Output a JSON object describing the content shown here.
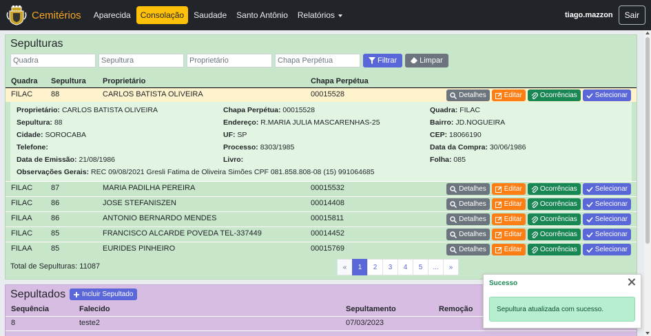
{
  "nav": {
    "brand": "Cemitérios",
    "links": [
      "Aparecida",
      "Consolação",
      "Saudade",
      "Santo Antônio",
      "Relatórios"
    ],
    "active": "Consolação",
    "user": "tiago.mazzon",
    "logout": "Sair"
  },
  "sepulturas": {
    "title": "Sepulturas",
    "filters": {
      "quadra": "Quadra",
      "sepultura": "Sepultura",
      "proprietario": "Proprietário",
      "chapa": "Chapa Perpétua"
    },
    "filter_btn": "Filtrar",
    "clear_btn": "Limpar",
    "columns": [
      "Quadra",
      "Sepultura",
      "Proprietário",
      "Chapa Perpétua"
    ],
    "actions": {
      "detalhes": "Detalhes",
      "editar": "Editar",
      "ocorrencias": "Ocorrências",
      "selecionar": "Selecionar"
    },
    "rows": [
      {
        "quadra": "FILAC",
        "sepultura": "88",
        "proprietario": "CARLOS BATISTA OLIVEIRA",
        "chapa": "00015528"
      },
      {
        "quadra": "FILAC",
        "sepultura": "87",
        "proprietario": "MARIA PADILHA PEREIRA",
        "chapa": "00015532"
      },
      {
        "quadra": "FILAC",
        "sepultura": "86",
        "proprietario": "JOSE STEFANISZEN",
        "chapa": "00014408"
      },
      {
        "quadra": "FILAA",
        "sepultura": "86",
        "proprietario": "ANTONIO BERNARDO MENDES",
        "chapa": "00015811"
      },
      {
        "quadra": "FILAC",
        "sepultura": "85",
        "proprietario": "FRANCISCO ALCARDE POVEDA TEL-337449",
        "chapa": "00014452"
      },
      {
        "quadra": "FILAA",
        "sepultura": "85",
        "proprietario": "EURIDES PINHEIRO",
        "chapa": "00015769"
      }
    ],
    "detail": {
      "proprietario_l": "Proprietário:",
      "proprietario": "CARLOS BATISTA OLIVEIRA",
      "chapa_l": "Chapa Perpétua:",
      "chapa": "00015528",
      "quadra_l": "Quadra:",
      "quadra": "FILAC",
      "sepultura_l": "Sepultura:",
      "sepultura": "88",
      "endereco_l": "Endereço:",
      "endereco": "R.MARIA JULIA MASCARENHAS-25",
      "bairro_l": "Bairro:",
      "bairro": "JD.NOGUEIRA",
      "cidade_l": "Cidade:",
      "cidade": "SOROCABA",
      "uf_l": "UF:",
      "uf": "SP",
      "cep_l": "CEP:",
      "cep": "18066190",
      "telefone_l": "Telefone:",
      "telefone": "",
      "processo_l": "Processo:",
      "processo": "8303/1985",
      "data_compra_l": "Data da Compra:",
      "data_compra": "30/06/1986",
      "data_emissao_l": "Data de Emissão:",
      "data_emissao": "21/08/1986",
      "livro_l": "Livro:",
      "livro": "",
      "folha_l": "Folha:",
      "folha": "085",
      "obs_l": "Observações Gerais:",
      "obs": "REC 09/08/2021 Gresli Fatima de Oliveira Simões CPF 081.858.808-08 (15) 991064685"
    },
    "total": "Total de Sepulturas: 11087",
    "pages": [
      "«",
      "1",
      "2",
      "3",
      "4",
      "5",
      "...",
      "»"
    ],
    "active_page": "1"
  },
  "sepultados": {
    "title": "Sepultados",
    "include_btn": "Incluir Sepultado",
    "columns": [
      "Sequência",
      "Falecido",
      "Sepultamento",
      "Remoção"
    ],
    "rows": [
      {
        "seq": "8",
        "falecido": "teste2",
        "sepultamento": "07/03/2023",
        "remocao": ""
      }
    ]
  },
  "toast": {
    "title": "Sucesso",
    "message": "Sepultura atualizada com sucesso."
  }
}
